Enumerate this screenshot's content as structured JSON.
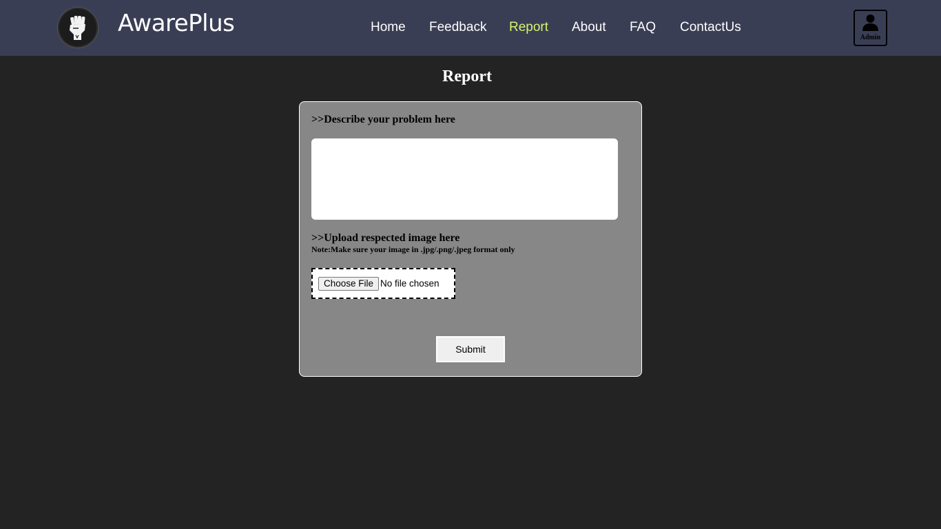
{
  "header": {
    "logo_icon": "raised-fist-icon",
    "brand": "AwarePlus",
    "nav": {
      "home": "Home",
      "feedback": "Feedback",
      "report": "Report",
      "about": "About",
      "faq": "FAQ",
      "contact": "ContactUs"
    },
    "active_nav": "Report",
    "active_color": "#d6f56a",
    "admin": {
      "icon": "user-icon",
      "label": "Admin"
    }
  },
  "main": {
    "title": "Report",
    "form": {
      "describe_label": ">>Describe your problem here",
      "problem_value": "",
      "upload_label": ">>Upload respected image here",
      "note": "Note:Make sure your image in .jpg/.png/.jpeg format only",
      "file_button": "Choose File",
      "file_status": "No file chosen",
      "submit": "Submit"
    }
  },
  "colors": {
    "background": "#232323",
    "navbar": "#3a3e55",
    "card": "#878787"
  }
}
